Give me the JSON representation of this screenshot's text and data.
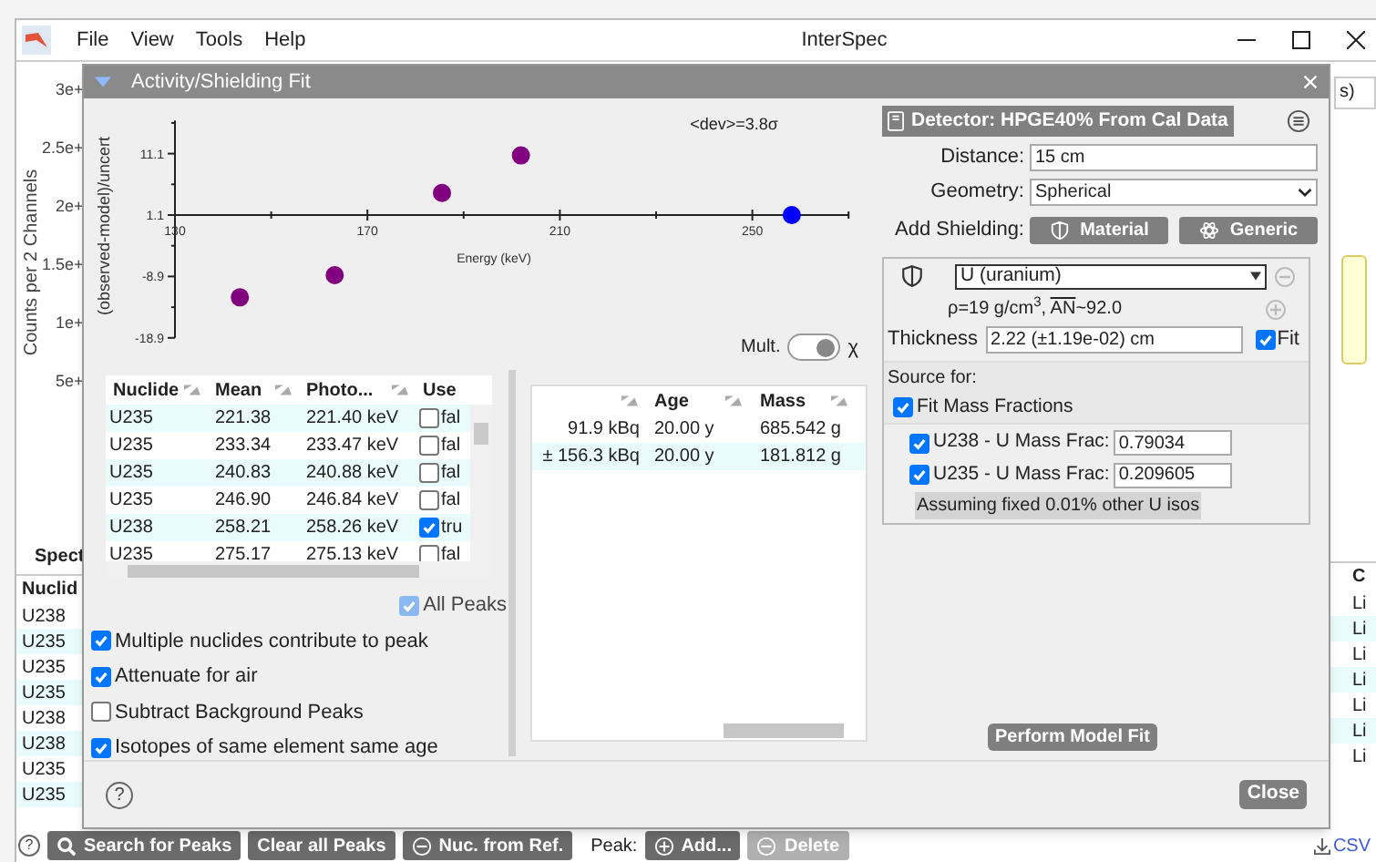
{
  "window": {
    "title": "InterSpec",
    "menu": [
      "File",
      "View",
      "Tools",
      "Help"
    ]
  },
  "background": {
    "y_axis_label": "Counts per 2 Channels",
    "y_ticks": [
      "3e+",
      "2.5e+",
      "2e+",
      "1.5e+",
      "1e+",
      "5e+"
    ],
    "panel_label": "Spect",
    "table": {
      "column": "Nuclid",
      "rows": [
        "U238",
        "U235",
        "U235",
        "U235",
        "U238",
        "U238",
        "U235",
        "U235"
      ]
    },
    "right_label": "s)",
    "right_table": {
      "column": "C",
      "rows": [
        "Li",
        "Li",
        "Li",
        "Li",
        "Li",
        "Li",
        "Li"
      ]
    },
    "csv_link": "CSV"
  },
  "toolbar": {
    "help": "?",
    "buttons": [
      {
        "label": "Search for Peaks"
      },
      {
        "label": "Clear all Peaks"
      },
      {
        "label": "Nuc. from Ref."
      }
    ],
    "peak_label": "Peak:",
    "peak_buttons": [
      {
        "label": "Add...",
        "disabled": false
      },
      {
        "label": "Delete",
        "disabled": true
      }
    ]
  },
  "dialog": {
    "title": "Activity/Shielding Fit",
    "deviation": "<dev>=3.8σ",
    "chart_data": {
      "type": "scatter",
      "xlabel": "Energy (keV)",
      "ylabel": "(observed-model)/uncert",
      "xlim": [
        130,
        270
      ],
      "ylim": [
        -18.9,
        16.5
      ],
      "xticks": [
        130,
        170,
        210,
        250
      ],
      "yticks": [
        11.1,
        1.1,
        -8.9,
        -18.9
      ],
      "series": [
        {
          "color": "#800080",
          "x": [
            143.5,
            163.2,
            185.5,
            201.9
          ],
          "values": [
            -12.3,
            -8.7,
            4.7,
            10.8
          ]
        },
        {
          "color": "#0000ff",
          "x": [
            258.2
          ],
          "values": [
            1.1
          ]
        }
      ]
    },
    "mult_toggle": {
      "label": "Mult.",
      "symbol": "χ",
      "on": true
    },
    "peaks_table": {
      "columns": [
        "Nuclide",
        "Mean",
        "Photo...",
        "Use"
      ],
      "rows": [
        {
          "nuclide": "U235",
          "mean": "221.38",
          "photopeak": "221.40 keV",
          "use": false,
          "use_text": "fal"
        },
        {
          "nuclide": "U235",
          "mean": "233.34",
          "photopeak": "233.47 keV",
          "use": false,
          "use_text": "fal"
        },
        {
          "nuclide": "U235",
          "mean": "240.83",
          "photopeak": "240.88 keV",
          "use": false,
          "use_text": "fal"
        },
        {
          "nuclide": "U235",
          "mean": "246.90",
          "photopeak": "246.84 keV",
          "use": false,
          "use_text": "fal"
        },
        {
          "nuclide": "U238",
          "mean": "258.21",
          "photopeak": "258.26 keV",
          "use": true,
          "use_text": "tru"
        },
        {
          "nuclide": "U235",
          "mean": "275.17",
          "photopeak": "275.13 keV",
          "use": false,
          "use_text": "fal"
        }
      ]
    },
    "all_peaks": {
      "label": "All Peaks",
      "checked": true,
      "disabled": true
    },
    "options": [
      {
        "label": "Multiple nuclides contribute to peak",
        "checked": true
      },
      {
        "label": "Attenuate for air",
        "checked": true
      },
      {
        "label": "Subtract Background Peaks",
        "checked": false
      },
      {
        "label": "Isotopes of same element same age",
        "checked": true
      }
    ],
    "sources_table": {
      "columns": [
        "Age",
        "Mass"
      ],
      "rows": [
        {
          "activity": "91.9 kBq",
          "age": "20.00 y",
          "mass": "685.542 g"
        },
        {
          "activity": "± 156.3 kBq",
          "age": "20.00 y",
          "mass": "181.812 g"
        }
      ]
    },
    "detector": "Detector: HPGE40% From Cal Data",
    "distance": {
      "label": "Distance:",
      "value": "15 cm"
    },
    "geometry": {
      "label": "Geometry:",
      "value": "Spherical"
    },
    "add_shielding": {
      "label": "Add Shielding:",
      "buttons": [
        {
          "label": "Material"
        },
        {
          "label": "Generic"
        }
      ]
    },
    "shielding": {
      "material": "U (uranium)",
      "density": "ρ=19 g/cm$^{3}$,",
      "an_label": "AN",
      "an_value": "~92.0",
      "thickness_label": "Thickness",
      "thickness": "2.22 (±1.19e-02) cm",
      "fit_label": "Fit",
      "fit": true,
      "source_for": "Source for:",
      "fit_mass_fractions": {
        "label": "Fit Mass Fractions",
        "checked": true
      },
      "mass_fractions": [
        {
          "label": "U238 - U Mass Frac:",
          "value": "0.79034",
          "checked": true
        },
        {
          "label": "U235 - U Mass Frac:",
          "value": "0.209605",
          "checked": true
        }
      ],
      "note": "Assuming fixed 0.01% other U isos"
    },
    "perform_button": "Perform Model Fit",
    "help": "?",
    "close_button": "Close"
  }
}
